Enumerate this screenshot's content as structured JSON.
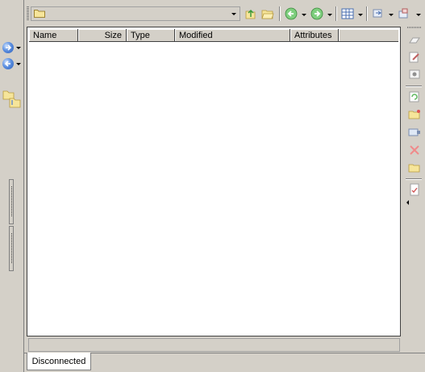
{
  "toolbar": {
    "path_value": "",
    "buttons": [
      {
        "name": "parent-folder",
        "icon": "folder-up-icon"
      },
      {
        "name": "open-folder",
        "icon": "open-folder-icon"
      },
      {
        "name": "back",
        "icon": "green-back-icon"
      },
      {
        "name": "forward",
        "icon": "green-forward-icon"
      },
      {
        "name": "view-mode",
        "icon": "grid-view-icon"
      },
      {
        "name": "transfer",
        "icon": "transfer-icon"
      },
      {
        "name": "queue",
        "icon": "queue-icon"
      }
    ]
  },
  "columns": [
    {
      "label": "Name"
    },
    {
      "label": "Size"
    },
    {
      "label": "Type"
    },
    {
      "label": "Modified"
    },
    {
      "label": "Attributes"
    }
  ],
  "rows": [],
  "status_text": "",
  "tabs": [
    {
      "label": "Disconnected"
    }
  ],
  "right_strip_icons": [
    "rename-icon",
    "edit-icon",
    "view-icon",
    "refresh-icon",
    "new-folder-icon",
    "properties-icon",
    "delete-icon",
    "folder-icon",
    "checklist-icon"
  ],
  "colors": {
    "window": "#d4d0c8",
    "panel": "#ffffff",
    "accent_blue": "#2f5fb8",
    "accent_green": "#5fb85f"
  }
}
